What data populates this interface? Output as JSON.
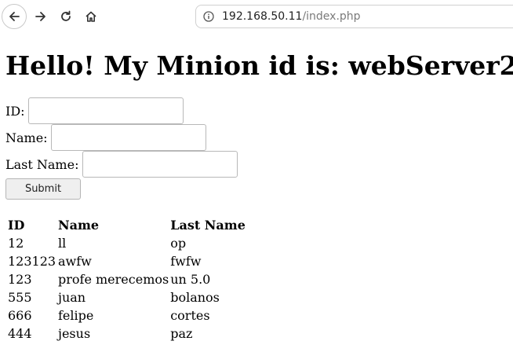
{
  "browser": {
    "url_host": "192.168.50.11",
    "url_path": "/index.php",
    "icons": [
      "back-icon",
      "forward-icon",
      "reload-icon",
      "home-icon",
      "site-info-icon"
    ]
  },
  "page": {
    "heading": "Hello! My Minion id is: webServer2",
    "form": {
      "id_label": "ID:",
      "id_value": "",
      "name_label": "Name:",
      "name_value": "",
      "lastname_label": "Last Name:",
      "lastname_value": "",
      "submit_label": "Submit"
    },
    "table": {
      "headers": [
        "ID",
        "Name",
        "Last Name"
      ],
      "rows": [
        [
          "12",
          "ll",
          "op"
        ],
        [
          "123123",
          "awfw",
          "fwfw"
        ],
        [
          "123",
          "profe merecemos",
          "un 5.0"
        ],
        [
          "555",
          "juan",
          "bolanos"
        ],
        [
          "666",
          "felipe",
          "cortes"
        ],
        [
          "444",
          "jesus",
          "paz"
        ]
      ]
    }
  }
}
